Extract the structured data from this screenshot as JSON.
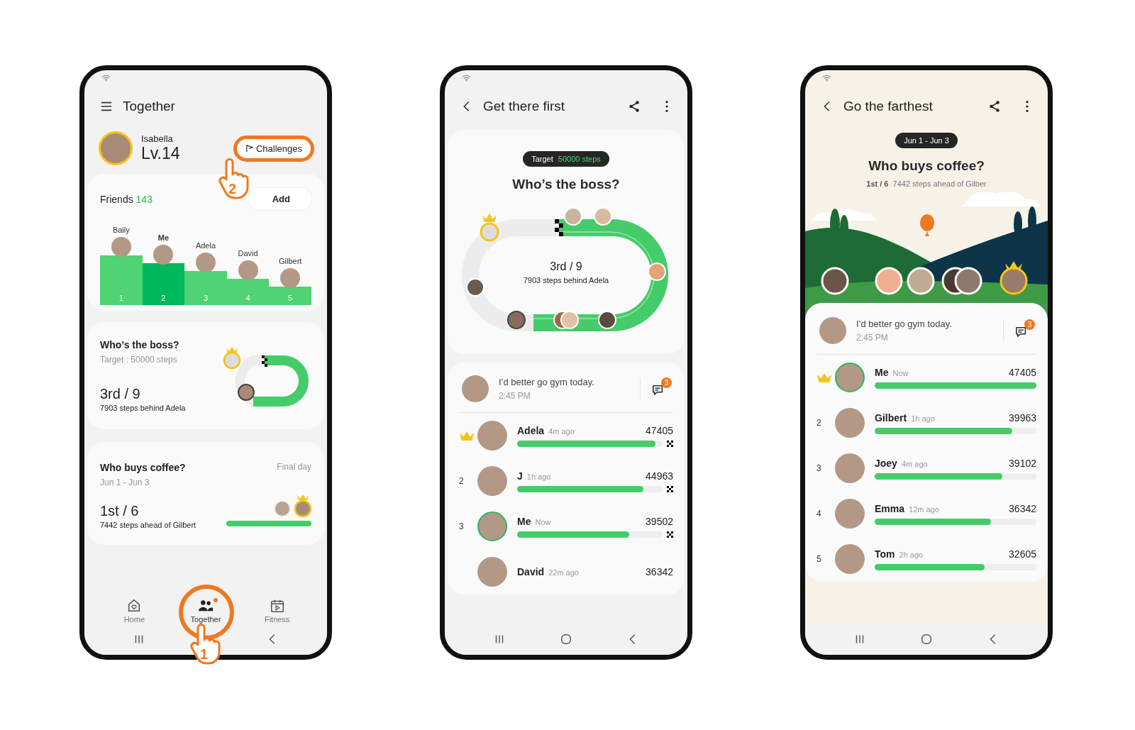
{
  "home_screen": {
    "title": "Together",
    "profile": {
      "name": "Isabella",
      "level_label": "Lv.14"
    },
    "challenges_button": {
      "label": "Challenges",
      "tap_step": "2"
    },
    "friends": {
      "label": "Friends",
      "count": "143",
      "add_button": "Add",
      "podium": [
        {
          "name": "Baily",
          "rank": "1",
          "is_me": false
        },
        {
          "name": "Me",
          "rank": "2",
          "is_me": true
        },
        {
          "name": "Adela",
          "rank": "3",
          "is_me": false
        },
        {
          "name": "David",
          "rank": "4",
          "is_me": false
        },
        {
          "name": "Gilbert",
          "rank": "5",
          "is_me": false
        }
      ]
    },
    "boss_card": {
      "title": "Who’s the boss?",
      "subtitle": "Target : 50000 steps",
      "rank": "3rd / 9",
      "note": "7903 steps behind Adela"
    },
    "coffee_card": {
      "title": "Who buys coffee?",
      "subtitle": "Jun 1 - Jun 3",
      "status": "Final day",
      "rank": "1st / 6",
      "note": "7442 steps ahead of Gilbert",
      "level": 1
    },
    "nav": [
      {
        "kind": "home",
        "label": "Home",
        "selected": false,
        "new_dot": false
      },
      {
        "kind": "together",
        "label": "Together",
        "selected": true,
        "new_dot": true,
        "tap_step": "1"
      },
      {
        "kind": "fitness",
        "label": "Fitness",
        "selected": false,
        "new_dot": false
      }
    ]
  },
  "detail_screens": [
    {
      "kind": "track",
      "title": "Get there first",
      "tooltip": {
        "label": "Target",
        "value": "50000 steps"
      },
      "heading": "Who’s the boss?",
      "rank": "3rd / 9",
      "note": "7903 steps behind Adela",
      "finish_flags": true,
      "message": {
        "text": "I’d better go gym today.",
        "time": "2:45 PM",
        "unread": "3"
      },
      "rows": [
        {
          "kind": "crown",
          "name": "Adela",
          "time": "4m ago",
          "steps": "47405",
          "level": 0.95,
          "is_me": false
        },
        {
          "kind": "number",
          "rank": "2",
          "name": "J",
          "time": "1h ago",
          "steps": "44963",
          "level": 0.87,
          "is_me": false
        },
        {
          "kind": "number",
          "rank": "3",
          "name": "Me",
          "time": "Now",
          "steps": "39502",
          "level": 0.77,
          "is_me": true
        },
        {
          "kind": "cut",
          "name": "David",
          "time": "22m ago",
          "steps": "36342",
          "is_me": false
        }
      ]
    },
    {
      "kind": "landscape",
      "title": "Go the farthest",
      "tooltip": {
        "label": "Jun 1 - Jun 3"
      },
      "heading": "Who buys coffee?",
      "rank": "1st / 6",
      "note": "7442 steps ahead of Gilber",
      "finish_flags": false,
      "message": {
        "text": "I’d better go gym today.",
        "time": "2:45 PM",
        "unread": "3"
      },
      "rows": [
        {
          "kind": "crown",
          "name": "Me",
          "time": "Now",
          "steps": "47405",
          "level": 1,
          "is_me": true
        },
        {
          "kind": "number",
          "rank": "2",
          "name": "Gilbert",
          "time": "1h ago",
          "steps": "39963",
          "level": 0.85,
          "is_me": false
        },
        {
          "kind": "number",
          "rank": "3",
          "name": "Joey",
          "time": "4m ago",
          "steps": "39102",
          "level": 0.79,
          "is_me": false
        },
        {
          "kind": "number",
          "rank": "4",
          "name": "Emma",
          "time": "12m ago",
          "steps": "36342",
          "level": 0.72,
          "is_me": false
        },
        {
          "kind": "number",
          "rank": "5",
          "name": "Tom",
          "time": "2h ago",
          "steps": "32605",
          "level": 0.68,
          "is_me": false
        }
      ]
    }
  ]
}
